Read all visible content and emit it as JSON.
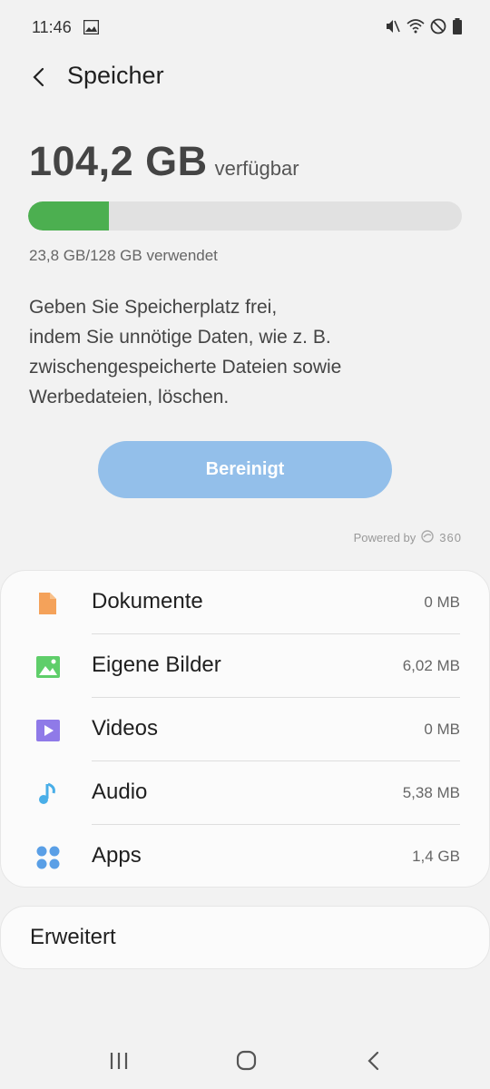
{
  "status_bar": {
    "time": "11:46",
    "left_icons": [
      "image-icon"
    ],
    "right_icons": [
      "mute-icon",
      "wifi-icon",
      "dnd-icon",
      "battery-icon"
    ]
  },
  "header": {
    "title": "Speicher",
    "back_icon": "chevron-left-icon"
  },
  "storage": {
    "available": "104,2 GB",
    "available_label": "verfügbar",
    "used_fraction": 0.186,
    "used_text": "23,8 GB/128 GB verwendet",
    "bar_color": "#4caf50"
  },
  "description": {
    "lines": [
      "Geben Sie Speicherplatz frei,",
      "indem Sie unnötige Daten, wie z. B.",
      "zwischengespeicherte Dateien sowie",
      "Werbedateien, löschen."
    ]
  },
  "clean_button": {
    "label": "Bereinigt",
    "color": "#93bfea"
  },
  "powered_by": {
    "label": "Powered by",
    "brand": "360"
  },
  "categories": [
    {
      "label": "Dokumente",
      "size": "0 MB",
      "icon": "document-icon",
      "color": "#f4a25a"
    },
    {
      "label": "Eigene Bilder",
      "size": "6,02 MB",
      "icon": "image-icon",
      "color": "#5fce6a"
    },
    {
      "label": "Videos",
      "size": "0 MB",
      "icon": "video-icon",
      "color": "#8f7ae8"
    },
    {
      "label": "Audio",
      "size": "5,38 MB",
      "icon": "music-note-icon",
      "color": "#49aee8"
    },
    {
      "label": "Apps",
      "size": "1,4 GB",
      "icon": "apps-icon",
      "color": "#5a9fe6"
    }
  ],
  "advanced": {
    "label": "Erweitert"
  },
  "navbar": {
    "icons": [
      "recents-icon",
      "home-icon",
      "back-icon"
    ]
  }
}
